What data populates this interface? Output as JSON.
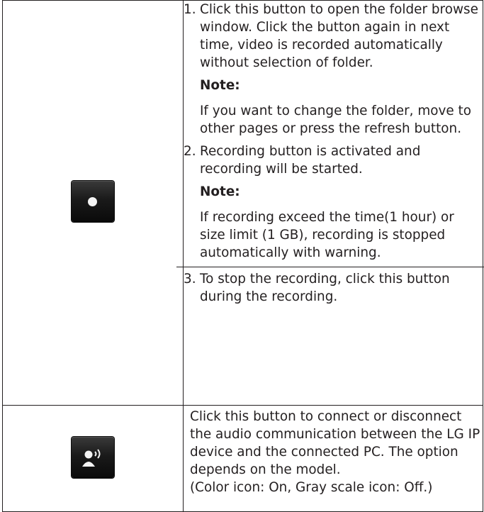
{
  "row1": {
    "icon": "record-button-icon",
    "items": [
      {
        "num": "1.",
        "text": "Click this button to open the folder browse window. Click the button again in next time, video is recorded automatically without selection of folder.",
        "note_head": "Note:",
        "note_body": "If you want to change the folder, move to other pages or press the refresh button."
      },
      {
        "num": "2.",
        "text": "Recording button is activated and recording will be started.",
        "note_head": "Note:",
        "note_body": "If recording exceed the time(1 hour) or size limit (1 GB), recording is stopped automatically with warning."
      },
      {
        "num": "3.",
        "text": "To stop the recording, click this button during the recording."
      }
    ]
  },
  "row2": {
    "icon": "audio-talk-button-icon",
    "text": "Click this button to connect or disconnect the audio communication between the LG IP device and the connected PC. The option depends on the model.",
    "text2": "(Color icon: On, Gray scale icon: Off.)"
  }
}
